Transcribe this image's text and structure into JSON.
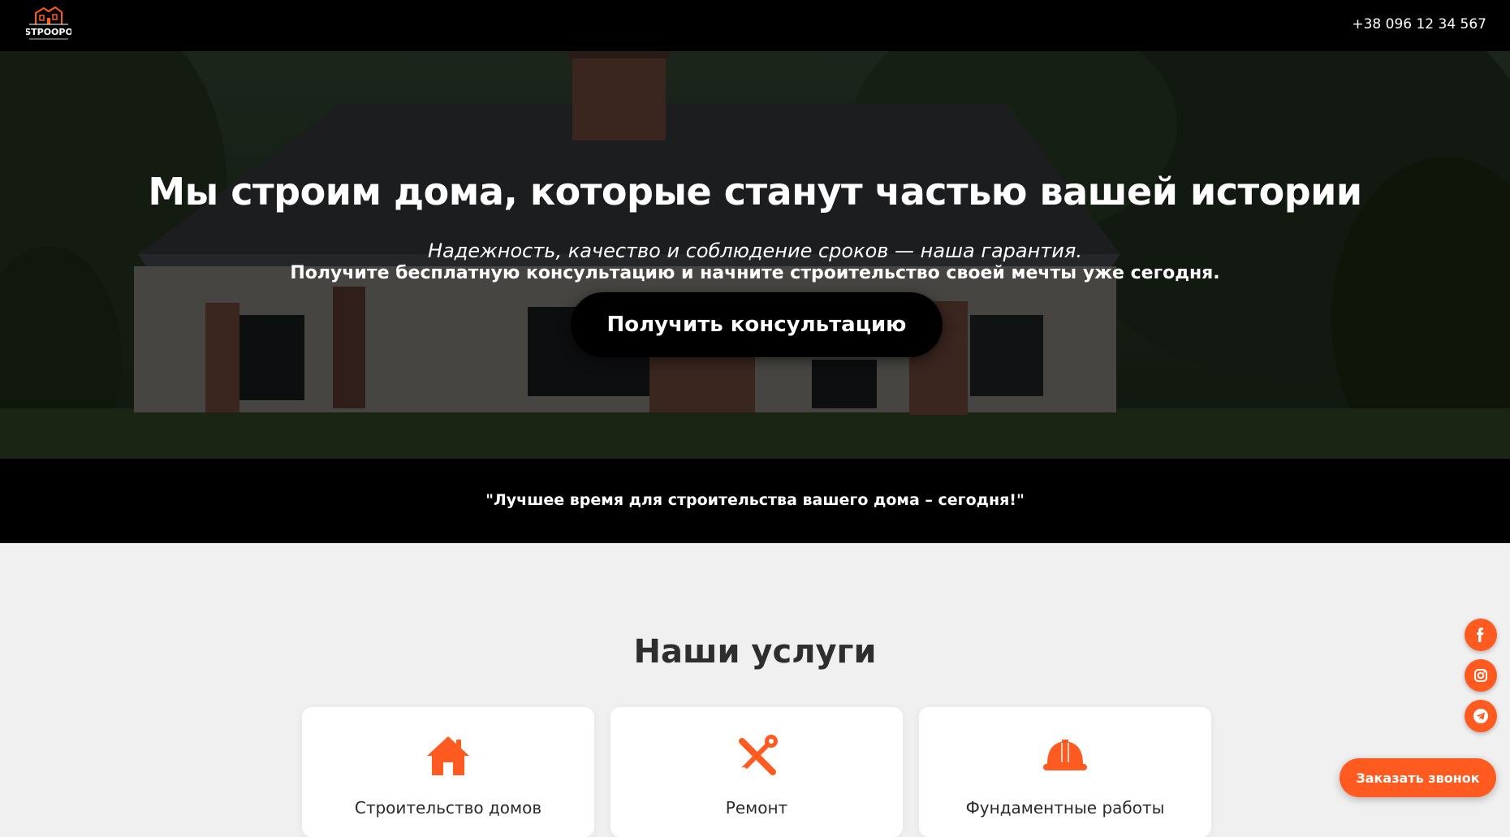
{
  "header": {
    "logo_text": "STPOOPO",
    "phone": "+38 096 12 34 567"
  },
  "hero": {
    "title": "Мы строим дома, которые станут частью вашей истории",
    "subtitle": "Надежность, качество и соблюдение сроков — наша гарантия.",
    "subtitle2": "Получите бесплатную консультацию и начните строительство своей мечты уже сегодня.",
    "cta_label": "Получить консультацию"
  },
  "quote": {
    "text": "\"Лучшее время для строительства вашего дома – сегодня!\""
  },
  "services": {
    "title": "Наши услуги",
    "items": [
      {
        "label": "Строительство домов",
        "icon": "house-icon"
      },
      {
        "label": "Ремонт",
        "icon": "tools-icon"
      },
      {
        "label": "Фундаментные работы",
        "icon": "hard-hat-icon"
      }
    ]
  },
  "social": {
    "items": [
      {
        "icon": "facebook-icon"
      },
      {
        "icon": "instagram-icon"
      },
      {
        "icon": "telegram-icon"
      }
    ]
  },
  "callback": {
    "label": "Заказать звонок"
  },
  "colors": {
    "accent": "#ff5a1f",
    "header_bg": "#000000",
    "page_bg": "#f0f0f0"
  }
}
